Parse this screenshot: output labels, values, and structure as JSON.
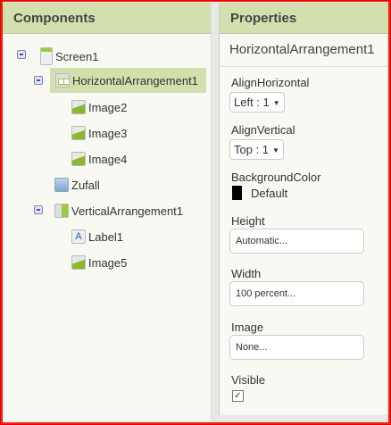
{
  "components": {
    "title": "Components",
    "tree": [
      {
        "label": "Screen1",
        "icon": "screen-icon"
      },
      {
        "label": "HorizontalArrangement1",
        "icon": "horizontal-arrangement-icon"
      },
      {
        "label": "Image2",
        "icon": "image-icon"
      },
      {
        "label": "Image3",
        "icon": "image-icon"
      },
      {
        "label": "Image4",
        "icon": "image-icon"
      },
      {
        "label": "Zufall",
        "icon": "button-icon"
      },
      {
        "label": "VerticalArrangement1",
        "icon": "vertical-arrangement-icon"
      },
      {
        "label": "Label1",
        "icon": "label-icon"
      },
      {
        "label": "Image5",
        "icon": "image-icon"
      }
    ],
    "label_icon_glyph": "A"
  },
  "properties": {
    "title": "Properties",
    "component": "HorizontalArrangement1",
    "align_horizontal": {
      "label": "AlignHorizontal",
      "value": "Left : 1"
    },
    "align_vertical": {
      "label": "AlignVertical",
      "value": "Top : 1"
    },
    "background_color": {
      "label": "BackgroundColor",
      "value": "Default",
      "color": "#000000"
    },
    "height": {
      "label": "Height",
      "value": "Automatic..."
    },
    "width": {
      "label": "Width",
      "value": "100 percent..."
    },
    "image": {
      "label": "Image",
      "value": "None..."
    },
    "visible": {
      "label": "Visible",
      "checked": true,
      "glyph": "✓"
    }
  }
}
